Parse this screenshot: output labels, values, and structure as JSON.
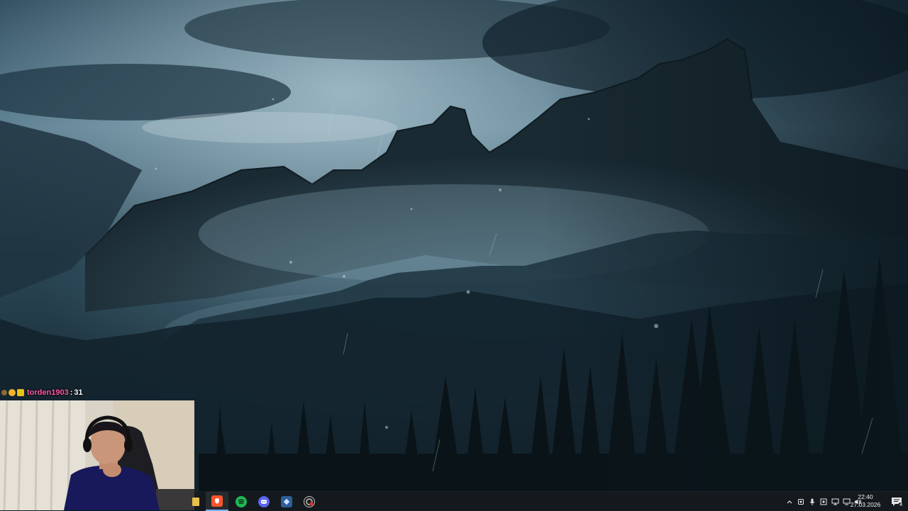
{
  "chat": {
    "username": "torden1903",
    "separator": ":",
    "message": "31",
    "username_color": "#ff5aa8"
  },
  "taskbar": {
    "apps": [
      {
        "name": "brave-icon",
        "color": "#fb542b"
      },
      {
        "name": "spotify-icon",
        "color": "#1db954"
      },
      {
        "name": "discord-icon",
        "color": "#5865f2"
      },
      {
        "name": "app-icon",
        "color": "#4a90d9"
      },
      {
        "name": "obs-icon",
        "color": "#e04040"
      }
    ],
    "clock": {
      "time": "22:40",
      "date": "27.03.2026"
    },
    "notification_count": "4"
  }
}
